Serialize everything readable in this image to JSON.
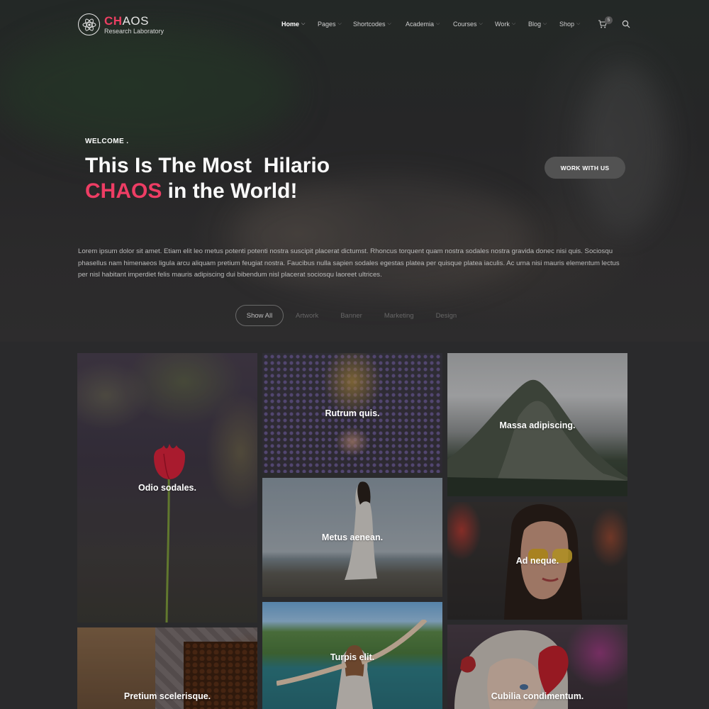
{
  "brand": {
    "name_accent": "CH",
    "name_rest": "AOS",
    "subtitle": "Research Laboratory"
  },
  "nav": [
    {
      "label": "Home",
      "active": true
    },
    {
      "label": "Pages"
    },
    {
      "label": "Shortcodes"
    },
    {
      "label": "Academia"
    },
    {
      "label": "Courses"
    },
    {
      "label": "Work"
    },
    {
      "label": "Blog"
    },
    {
      "label": "Shop"
    }
  ],
  "cart": {
    "count": "5"
  },
  "hero": {
    "welcome": "WELCOME .",
    "line1": "This Is The Most  Hilario",
    "line2_accent": "CHAOS",
    "line2_rest": " in the World!",
    "cta": "WORK WITH US",
    "body": "Lorem ipsum dolor sit amet. Etiam elit leo metus potenti potenti nostra suscipit placerat dictumst. Rhoncus torquent quam nostra sodales nostra gravida donec nisi quis. Sociosqu phasellus nam himenaeos ligula arcu aliquam pretium feugiat nostra. Faucibus nulla sapien sodales egestas platea per quisque platea iaculis. Ac urna nisi mauris elementum lectus per nisl habitant imperdiet felis mauris adipiscing dui bibendum nisl placerat sociosqu laoreet ultrices."
  },
  "filters": [
    "Show All",
    "Artwork",
    "Banner",
    "Marketing",
    "Design"
  ],
  "portfolio": [
    {
      "title": "Odio sodales."
    },
    {
      "title": "Rutrum quis."
    },
    {
      "title": "Massa adipiscing."
    },
    {
      "title": "Metus aenean."
    },
    {
      "title": "Ad neque."
    },
    {
      "title": "Pretium scelerisque."
    },
    {
      "title": "Turpis elit."
    },
    {
      "title": "Cubilia condimentum."
    }
  ],
  "colors": {
    "accent": "#ee3d64",
    "background": "#2a2a2c"
  }
}
